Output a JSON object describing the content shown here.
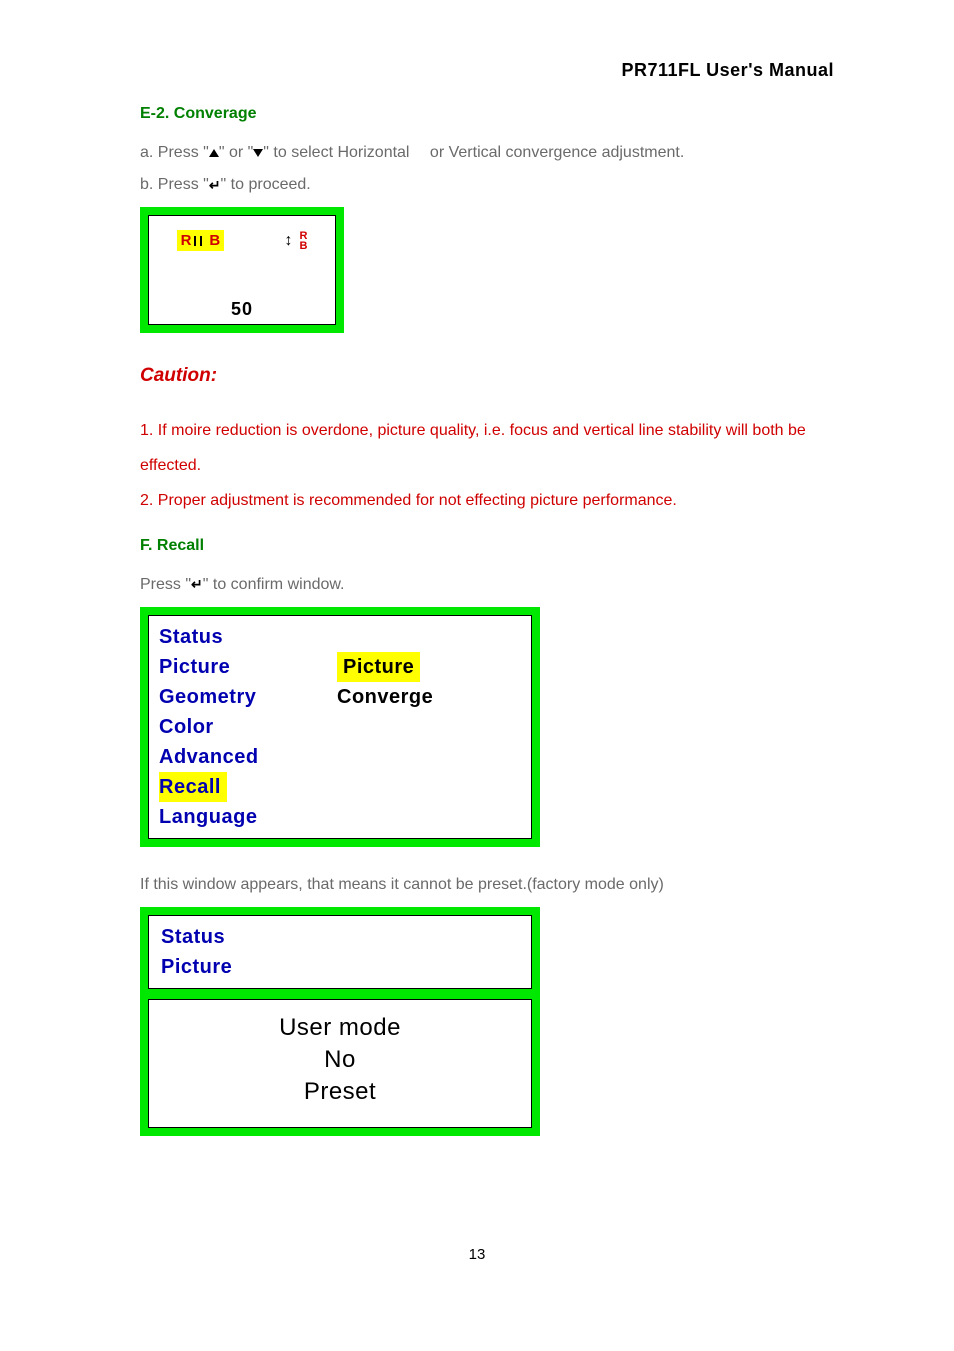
{
  "header": {
    "title": "PR711FL User's Manual"
  },
  "section_e2": {
    "heading": "E-2. Converage",
    "line_a_1": "a. Press \"",
    "line_a_2": "\" or \"",
    "line_a_3": "\" to select Horizontal  or Vertical convergence adjustment.",
    "line_b_1": "b. Press \"",
    "line_b_2": "\" to proceed.",
    "conv_value": "50",
    "conv_r": "R",
    "conv_b": "B"
  },
  "caution": {
    "heading": "Caution:",
    "line1": "1. If moire reduction is overdone, picture quality, i.e. focus and vertical line stability will both be effected.",
    "line2": "2. Proper adjustment is recommended for not effecting picture performance."
  },
  "section_f": {
    "heading": " F. Recall",
    "press_1": "Press \"",
    "press_2": "\" to confirm window.",
    "menu_left": [
      "Status",
      "Picture",
      "Geometry",
      "Color",
      "Advanced",
      "Recall",
      "Language"
    ],
    "menu_left_highlight_index": 5,
    "menu_right": [
      {
        "label": "Picture",
        "highlight": true
      },
      {
        "label": "Converge",
        "highlight": false
      }
    ],
    "note": "If this window appears, that means it cannot be preset.(factory mode only)",
    "box2_top": [
      "Status",
      "Picture"
    ],
    "box2_msg": [
      "User mode",
      "No",
      "Preset"
    ]
  },
  "page_number": "13"
}
